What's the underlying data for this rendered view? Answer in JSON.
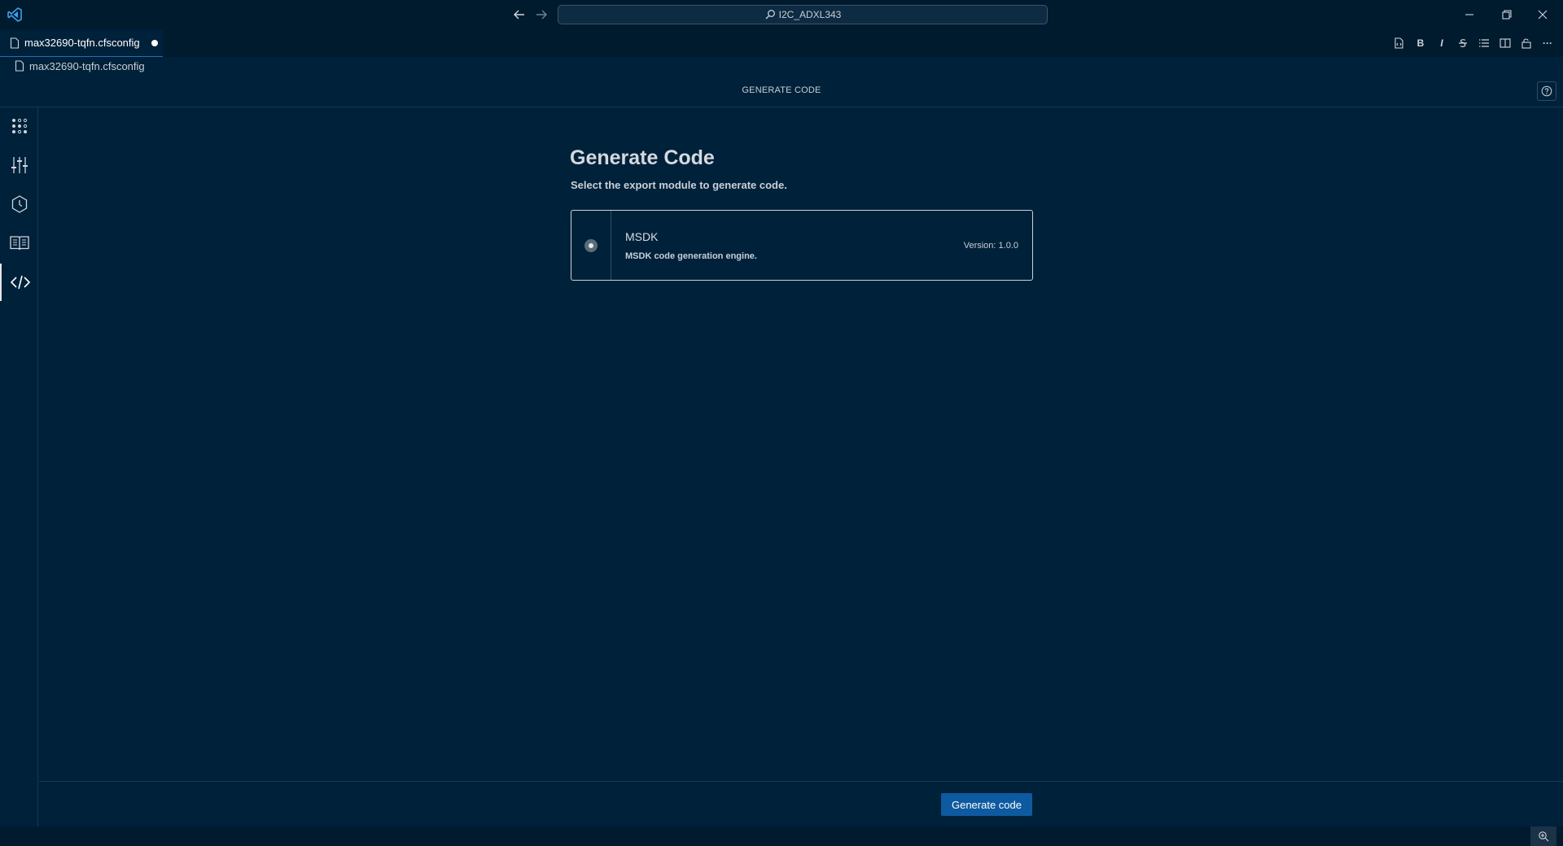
{
  "titlebar": {
    "search_text": "I2C_ADXL343",
    "icons": [
      "vscode-logo-icon",
      "arrow-left-icon",
      "arrow-right-icon",
      "search-icon",
      "minimize-icon",
      "restore-icon",
      "close-icon"
    ]
  },
  "tab": {
    "label": "max32690-tqfn.cfsconfig",
    "dirty": true
  },
  "editor_actions": {
    "icons": [
      "open-source-icon",
      "bold-icon",
      "italic-icon",
      "strikethrough-icon",
      "list-icon",
      "split-editor-icon",
      "lock-icon",
      "more-icon"
    ],
    "bold_glyph": "B",
    "italic_glyph": "I",
    "more_glyph": "···"
  },
  "breadcrumb": {
    "file": "max32690-tqfn.cfsconfig"
  },
  "page_header": {
    "title": "GENERATE CODE"
  },
  "rail": {
    "items": [
      "pinmux-icon",
      "config-sliders-icon",
      "clock-icon",
      "memory-book-icon",
      "code-icon"
    ],
    "active": "code-icon"
  },
  "main": {
    "title": "Generate Code",
    "subtitle": "Select the export module to generate code.",
    "modules": [
      {
        "name": "MSDK",
        "description": "MSDK code generation engine.",
        "version": "Version: 1.0.0",
        "selected": true
      }
    ]
  },
  "footer": {
    "generate_label": "Generate code"
  },
  "colors": {
    "background": "#00213a",
    "chrome": "#001a2e",
    "primary_button": "#0e5aa0"
  }
}
